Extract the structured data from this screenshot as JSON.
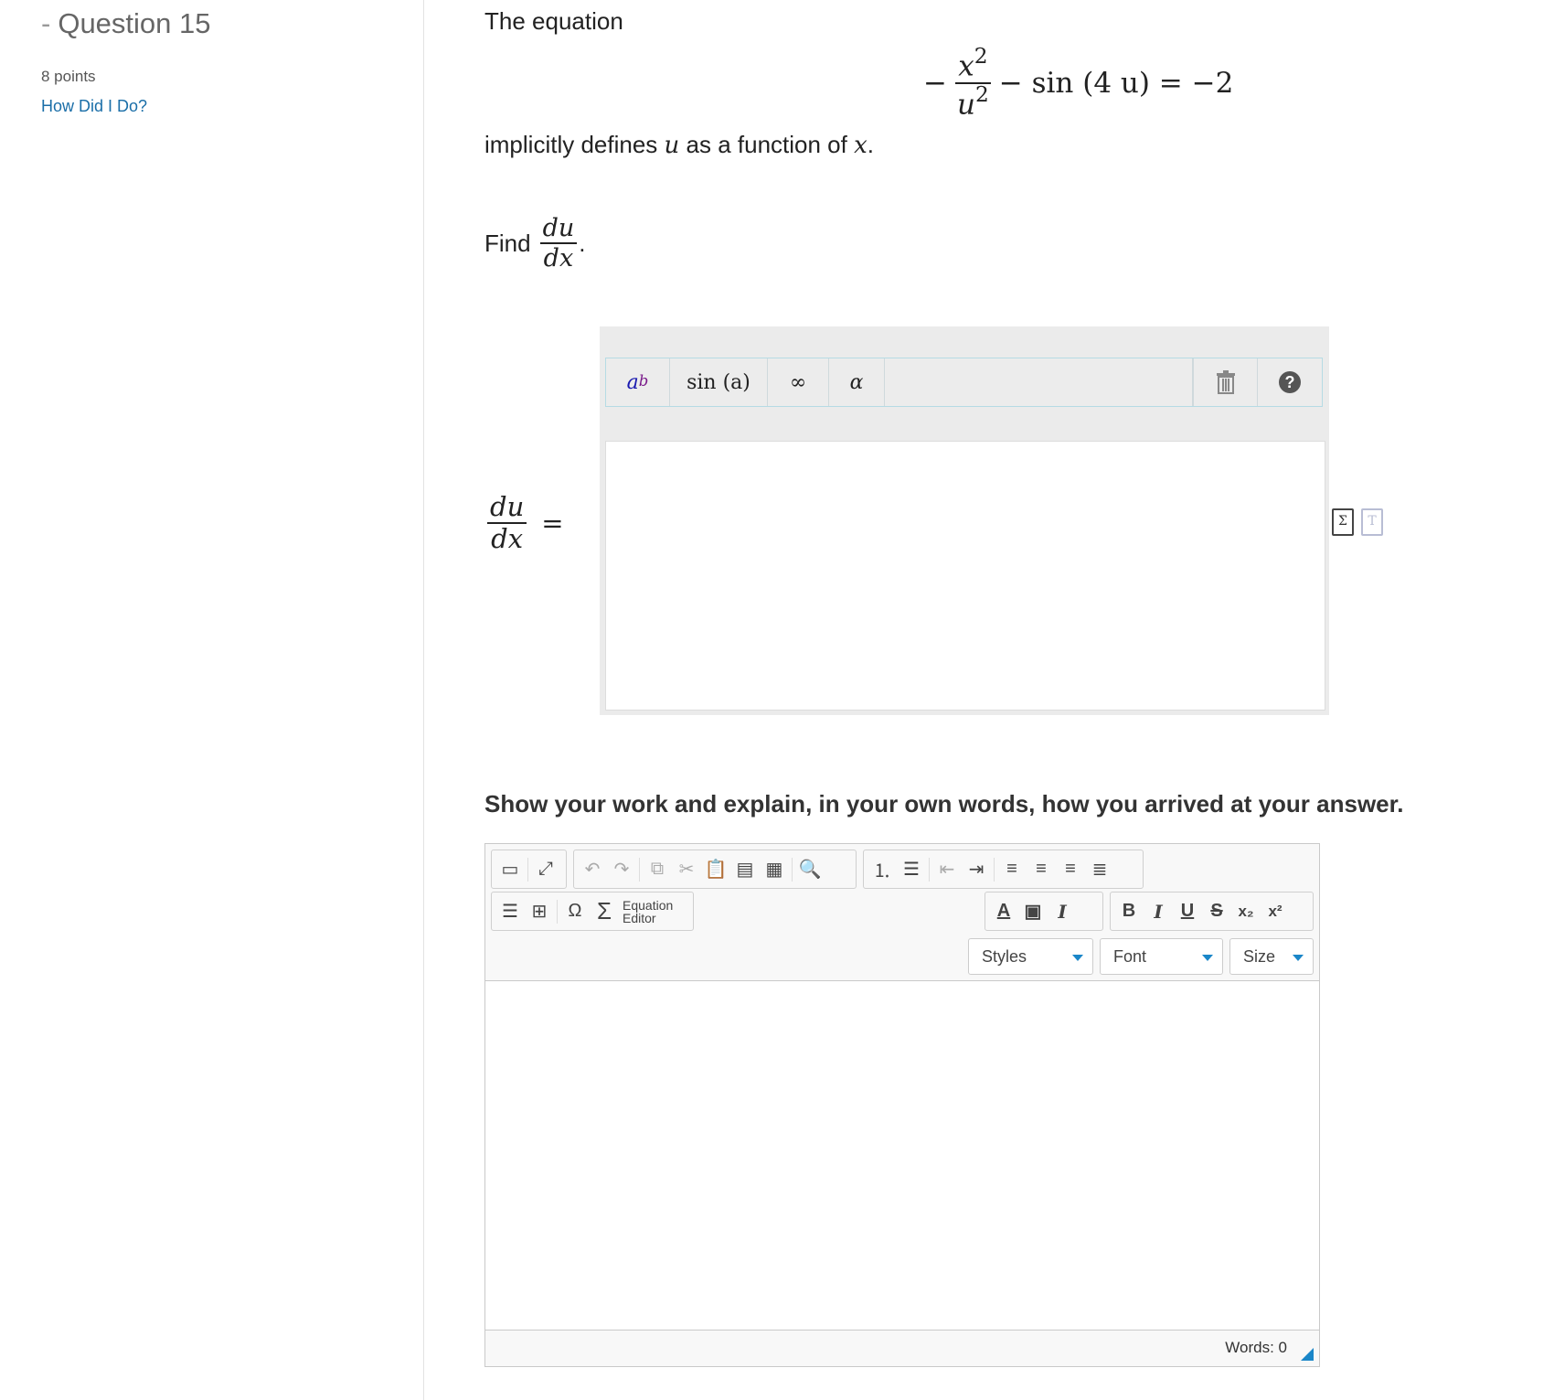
{
  "sidebar": {
    "question_title": "Question 15",
    "points": "8 points",
    "how_link": "How Did I Do?"
  },
  "question": {
    "intro": "The equation",
    "equation": {
      "neg": "−",
      "frac_num": "x",
      "frac_num_exp": "2",
      "frac_den": "u",
      "frac_den_exp": "2",
      "rest": "− sin (4 u) = −2"
    },
    "implicit_pre": "implicitly defines",
    "implicit_var1": "u",
    "implicit_mid": "as a function of",
    "implicit_var2": "x",
    "implicit_post": ".",
    "find_label": "Find",
    "derivative_num": "du",
    "derivative_den": "dx",
    "find_post": "."
  },
  "answer": {
    "lhs_num": "du",
    "lhs_den": "dx",
    "equals": "=",
    "palette": {
      "power": "a",
      "power_exp": "b",
      "sin": "sin (a)",
      "infinity": "∞",
      "alpha": "α",
      "trash": "🗑",
      "help": "?"
    }
  },
  "work": {
    "prompt": "Show your work and explain, in your own words, how you arrived at your answer.",
    "equation_editor_line1": "Equation",
    "equation_editor_line2": "Editor",
    "styles": "Styles",
    "font": "Font",
    "size": "Size",
    "words": "Words: 0"
  },
  "colors": {
    "link": "#1a6ea8",
    "accent": "#1a86c8"
  }
}
